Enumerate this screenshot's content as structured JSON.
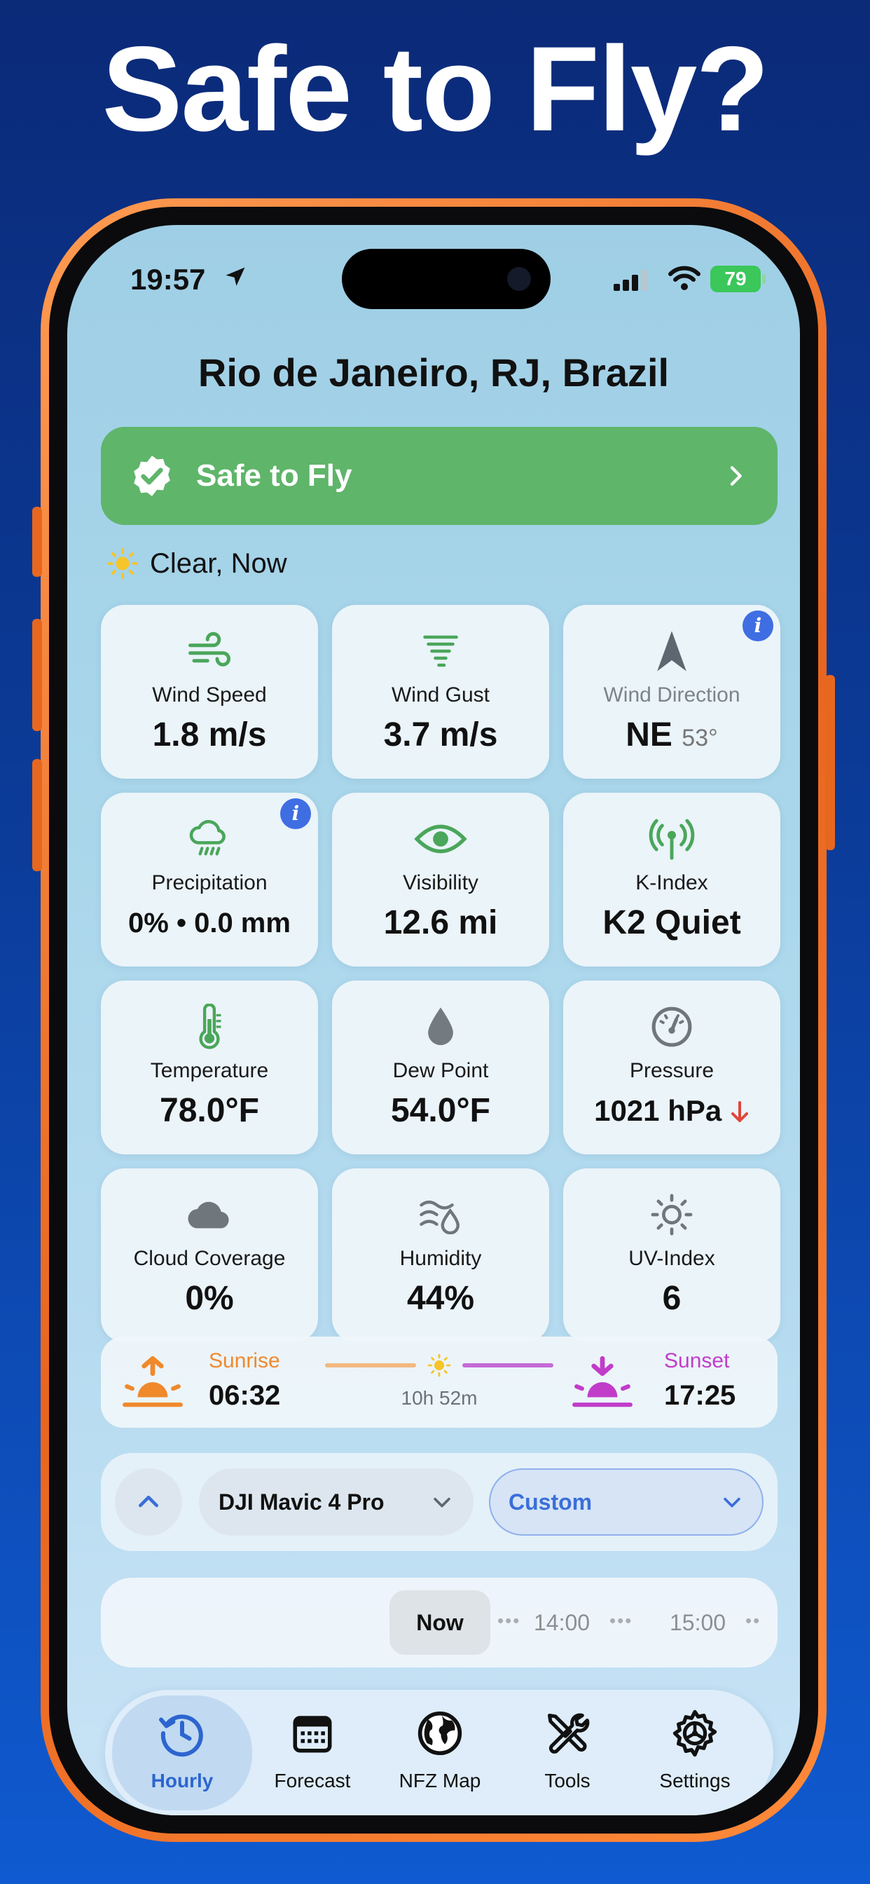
{
  "headline": "Safe to Fly?",
  "status_bar": {
    "time": "19:57",
    "battery": "79"
  },
  "location": "Rio de Janeiro, RJ, Brazil",
  "safety_banner": {
    "label": "Safe to Fly"
  },
  "condition": "Clear, Now",
  "tiles": {
    "wind_speed": {
      "label": "Wind Speed",
      "value": "1.8 m/s"
    },
    "wind_gust": {
      "label": "Wind Gust",
      "value": "3.7 m/s"
    },
    "wind_direction": {
      "label": "Wind Direction",
      "value": "NE",
      "sub": "53°"
    },
    "precipitation": {
      "label": "Precipitation",
      "value": "0% • 0.0 mm"
    },
    "visibility": {
      "label": "Visibility",
      "value": "12.6 mi"
    },
    "k_index": {
      "label": "K-Index",
      "value": "K2 Quiet"
    },
    "temperature": {
      "label": "Temperature",
      "value": "78.0°F"
    },
    "dew_point": {
      "label": "Dew Point",
      "value": "54.0°F"
    },
    "pressure": {
      "label": "Pressure",
      "value": "1021 hPa"
    },
    "cloud_coverage": {
      "label": "Cloud Coverage",
      "value": "0%"
    },
    "humidity": {
      "label": "Humidity",
      "value": "44%"
    },
    "uv_index": {
      "label": "UV-Index",
      "value": "6"
    }
  },
  "sun": {
    "sunrise_label": "Sunrise",
    "sunrise_time": "06:32",
    "daylight": "10h 52m",
    "sunset_label": "Sunset",
    "sunset_time": "17:25",
    "colors": {
      "sunrise": "#f0892b",
      "sunset": "#c13cc9"
    }
  },
  "controls": {
    "drone": "DJI Mavic 4 Pro",
    "profile": "Custom"
  },
  "timeline": {
    "items": [
      "Now",
      "14:00",
      "15:00"
    ]
  },
  "tabs": [
    {
      "label": "Hourly",
      "icon": "clock-icon"
    },
    {
      "label": "Forecast",
      "icon": "calendar-icon"
    },
    {
      "label": "NFZ Map",
      "icon": "globe-icon"
    },
    {
      "label": "Tools",
      "icon": "tools-icon"
    },
    {
      "label": "Settings",
      "icon": "gear-icon"
    }
  ],
  "colors": {
    "safe_green": "#5fb56a",
    "icon_green": "#4aa65a",
    "accent_blue": "#3a6fd8",
    "info_blue": "#3f6ee3",
    "phone_frame": "#e8651e"
  }
}
